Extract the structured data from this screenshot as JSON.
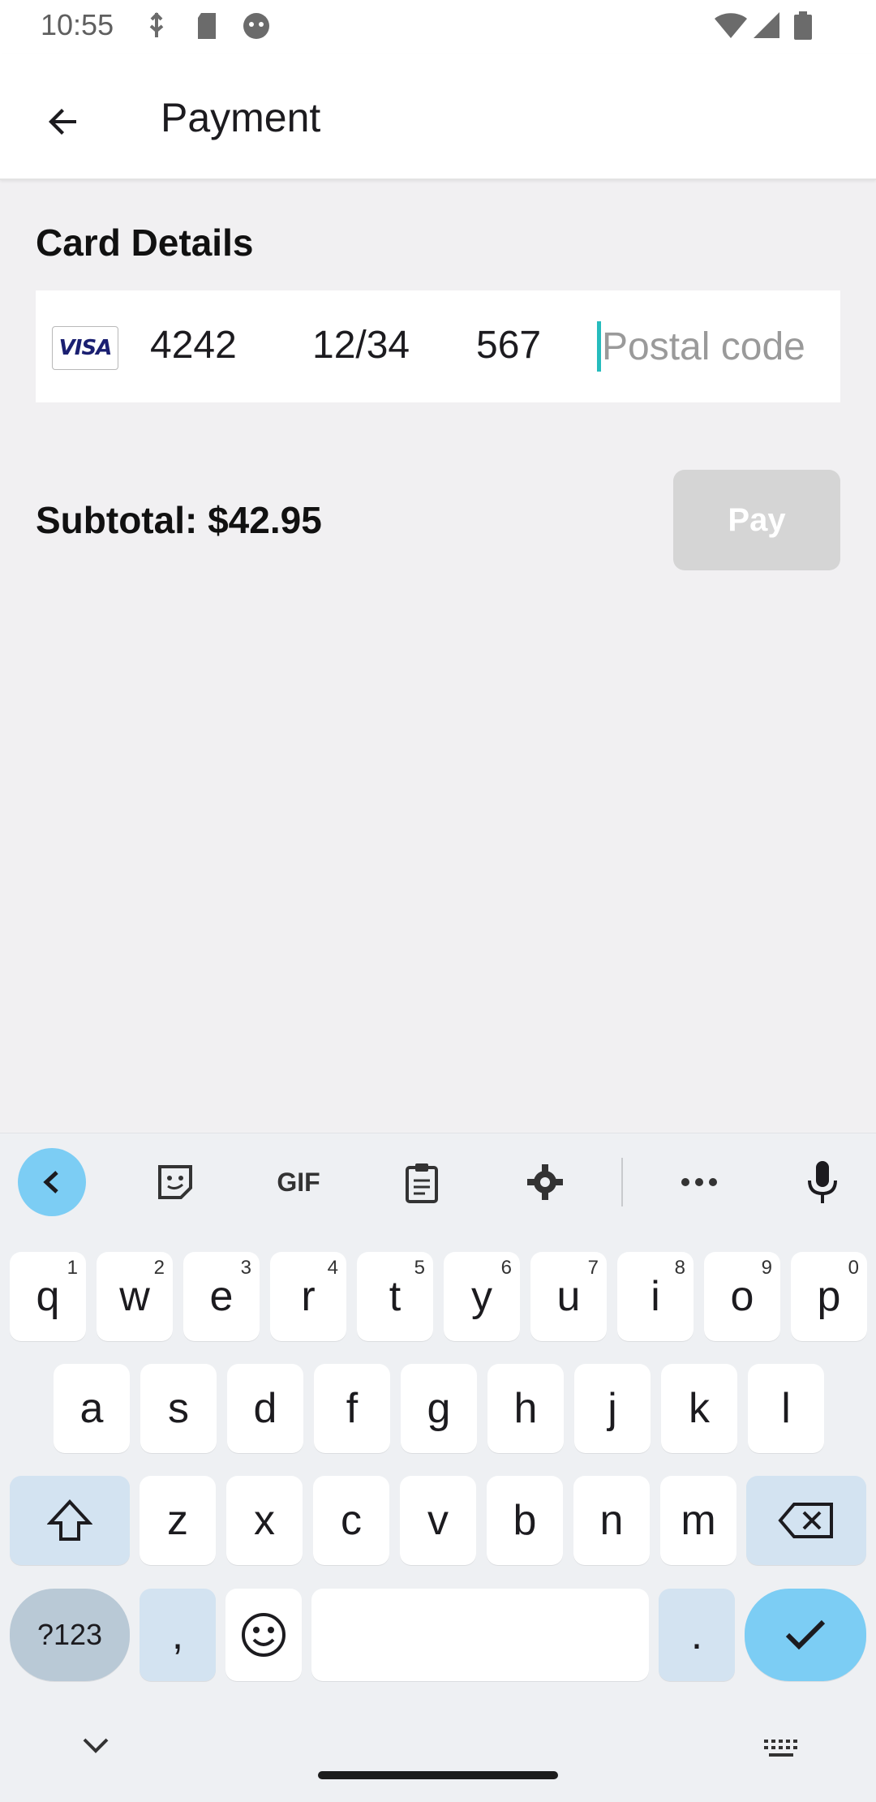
{
  "status_bar": {
    "time": "10:55",
    "left_icons": [
      "usb-debug-icon",
      "sd-card-icon",
      "android-bot-icon"
    ],
    "right_icons": [
      "wifi-icon",
      "cell-signal-icon",
      "battery-icon"
    ]
  },
  "app_bar": {
    "back_icon": "arrow-back-icon",
    "title": "Payment"
  },
  "card_details": {
    "title": "Card Details",
    "brand": "VISA",
    "card_last4": "4242",
    "expiry": "12/34",
    "cvc": "567",
    "postal_placeholder": "Postal code",
    "postal_value": ""
  },
  "summary": {
    "subtotal": "Subtotal: $42.95",
    "pay_label": "Pay",
    "pay_enabled": false
  },
  "keyboard": {
    "toolbar": [
      "back-arrow-icon",
      "sticker-icon",
      "gif-icon",
      "clipboard-icon",
      "gear-icon",
      "more-icon",
      "mic-icon"
    ],
    "gif_label": "GIF",
    "row1": [
      {
        "k": "q",
        "h": "1"
      },
      {
        "k": "w",
        "h": "2"
      },
      {
        "k": "e",
        "h": "3"
      },
      {
        "k": "r",
        "h": "4"
      },
      {
        "k": "t",
        "h": "5"
      },
      {
        "k": "y",
        "h": "6"
      },
      {
        "k": "u",
        "h": "7"
      },
      {
        "k": "i",
        "h": "8"
      },
      {
        "k": "o",
        "h": "9"
      },
      {
        "k": "p",
        "h": "0"
      }
    ],
    "row2": [
      "a",
      "s",
      "d",
      "f",
      "g",
      "h",
      "j",
      "k",
      "l"
    ],
    "row3": [
      "z",
      "x",
      "c",
      "v",
      "b",
      "n",
      "m"
    ],
    "symbols_label": "?123",
    "comma": ",",
    "period": "."
  },
  "nav_bar": {
    "icons": [
      "chevron-down-icon",
      "home-handle",
      "keyboard-switch-icon"
    ]
  },
  "colors": {
    "accent_caret": "#26bcbd",
    "keyboard_accent": "#7ccdf4",
    "pay_disabled": "#d5d5d5",
    "background": "#f1f0f2"
  }
}
